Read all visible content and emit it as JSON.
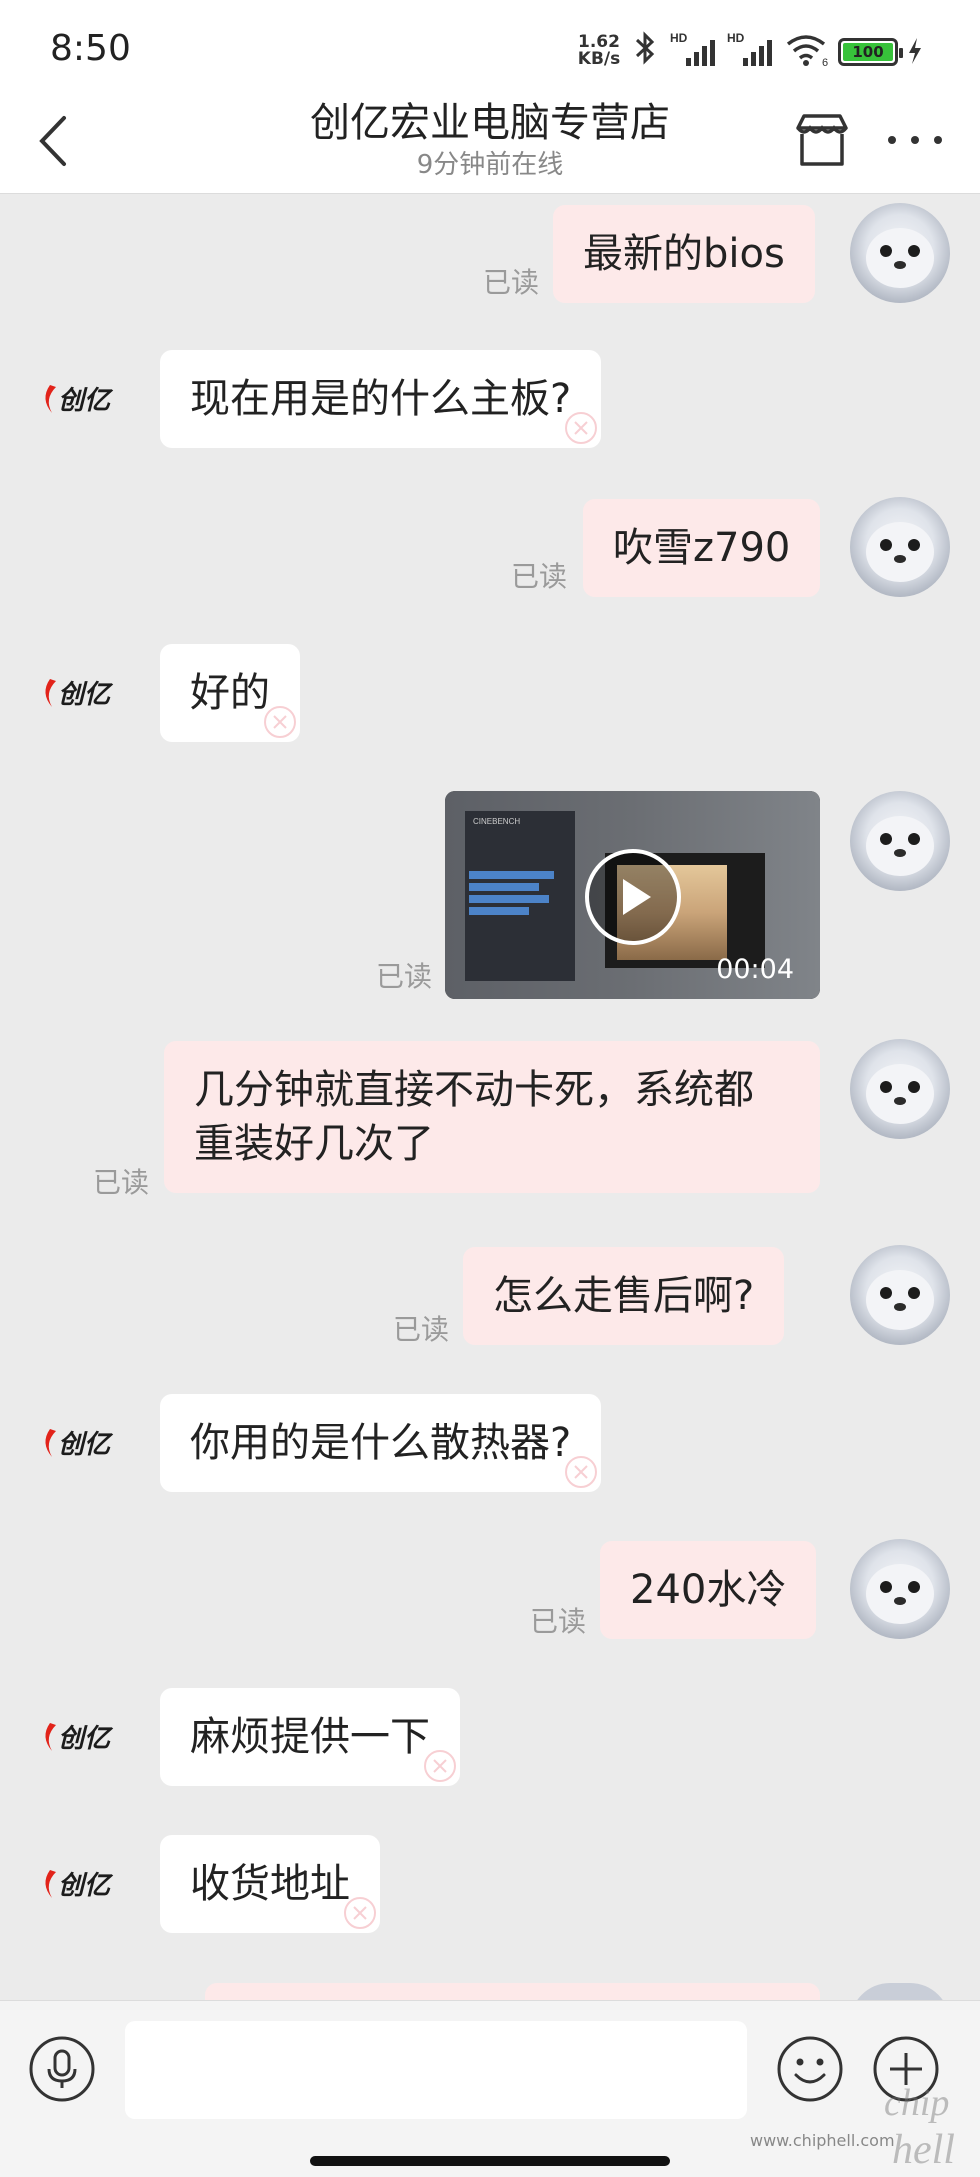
{
  "status_bar": {
    "time": "8:50",
    "net_speed_value": "1.62",
    "net_speed_unit": "KB/s",
    "signal_label": "HD",
    "wifi_label": "6",
    "battery": "100"
  },
  "header": {
    "title": "创亿宏业电脑专营店",
    "subtitle": "9分钟前在线"
  },
  "shop": {
    "logo_text": "创亿"
  },
  "read_label": "已读",
  "messages": [
    {
      "from": "me",
      "text": "最新的bios",
      "read": "已读"
    },
    {
      "from": "shop",
      "text": "现在用是的什么主板?"
    },
    {
      "from": "me",
      "text": "吹雪z790",
      "read": "已读"
    },
    {
      "from": "shop",
      "text": "好的"
    },
    {
      "from": "me",
      "type": "video",
      "duration": "00:04",
      "read": "已读",
      "screen_label": "CINEBENCH"
    },
    {
      "from": "me",
      "text": "几分钟就直接不动卡死，系统都重装好几次了",
      "read": "已读"
    },
    {
      "from": "me",
      "text": "怎么走售后啊?",
      "read": "已读"
    },
    {
      "from": "shop",
      "text": "你用的是什么散热器?"
    },
    {
      "from": "me",
      "text": "240水冷",
      "read": "已读"
    },
    {
      "from": "shop",
      "text": "麻烦提供一下"
    },
    {
      "from": "shop",
      "text": "收货地址"
    }
  ],
  "input": {
    "placeholder": ""
  },
  "watermark": {
    "url": "www.chiphell.com",
    "logo": "chip hell"
  },
  "colors": {
    "background": "#ebebeb",
    "my_bubble": "#fde9e9",
    "shop_bubble": "#ffffff",
    "brand_red": "#e2231a",
    "read_text": "#9a9a9a"
  }
}
